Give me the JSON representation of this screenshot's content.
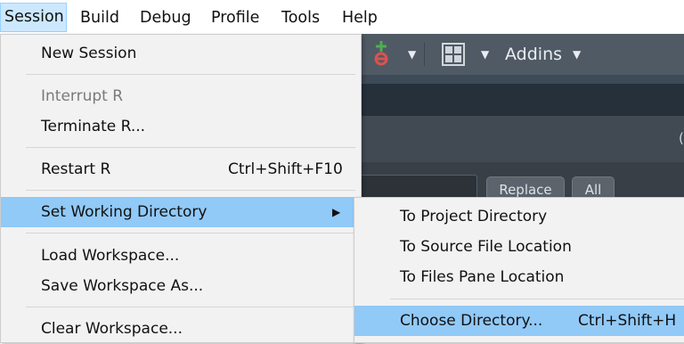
{
  "menubar": {
    "items": [
      "Session",
      "Build",
      "Debug",
      "Profile",
      "Tools",
      "Help"
    ]
  },
  "toolbar": {
    "addins_label": "Addins"
  },
  "find_bar": {
    "replace_label": "Replace",
    "all_label": "All"
  },
  "session_menu": {
    "new_session": "New Session",
    "interrupt_r": "Interrupt R",
    "terminate_r": "Terminate R...",
    "restart_r": "Restart R",
    "restart_r_shortcut": "Ctrl+Shift+F10",
    "set_working_directory": "Set Working Directory",
    "load_workspace": "Load Workspace...",
    "save_workspace_as": "Save Workspace As...",
    "clear_workspace": "Clear Workspace..."
  },
  "working_dir_submenu": {
    "to_project_directory": "To Project Directory",
    "to_source_file_location": "To Source File Location",
    "to_files_pane_location": "To Files Pane Location",
    "choose_directory": "Choose Directory...",
    "choose_directory_shortcut": "Ctrl+Shift+H"
  },
  "colors": {
    "menu_highlight": "#91c9f7",
    "menubar_active": "#cce8ff",
    "toolbar_bg": "#505a64",
    "git_icon_green": "#4caf50"
  },
  "icons": [
    "git-commit-icon",
    "grid-layout-icon",
    "chevron-down-icon",
    "submenu-arrow-icon"
  ]
}
